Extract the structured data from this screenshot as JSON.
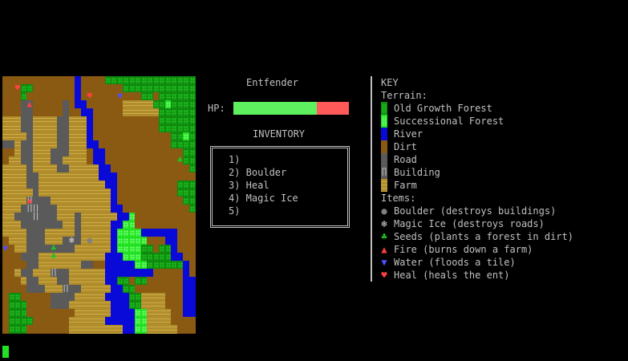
{
  "player": {
    "name": "Entfender",
    "hp_label": "HP:",
    "hp_fraction": 0.72
  },
  "inventory": {
    "title": "INVENTORY",
    "slots": [
      "1)",
      "2) Boulder",
      "3) Heal",
      "4) Magic Ice",
      "5)"
    ]
  },
  "key": {
    "title": "KEY",
    "terrain_title": "Terrain:",
    "terrain": [
      {
        "label": "Old Growth Forest",
        "icon": "old-growth-forest"
      },
      {
        "label": "Successional Forest",
        "icon": "successional-forest"
      },
      {
        "label": "River",
        "icon": "river"
      },
      {
        "label": "Dirt",
        "icon": "dirt"
      },
      {
        "label": "Road",
        "icon": "road"
      },
      {
        "label": "Building",
        "icon": "building",
        "glyph": "∏"
      },
      {
        "label": "Farm",
        "icon": "farm"
      }
    ],
    "items_title": "Items:",
    "items": [
      {
        "label": "Boulder (destroys buildings)",
        "glyph": "●",
        "color": "#808080",
        "icon": "boulder"
      },
      {
        "label": "Magic Ice (destroys roads)",
        "glyph": "❄",
        "color": "#e0e0e0",
        "icon": "magic-ice"
      },
      {
        "label": "Seeds (plants a forest in dirt)",
        "glyph": "♣",
        "color": "#22c022",
        "icon": "seeds"
      },
      {
        "label": "Fire (burns down a farm)",
        "glyph": "▲",
        "color": "#ff4040",
        "icon": "fire"
      },
      {
        "label": "Water (floods a tile)",
        "glyph": "▼",
        "color": "#5050ff",
        "icon": "water"
      },
      {
        "label": "Heal (heals the ent)",
        "glyph": "♥",
        "color": "#ff4040",
        "icon": "heal"
      }
    ]
  },
  "colors": {
    "old_growth": "#0f8a0f",
    "successional": "#22e022",
    "river": "#0a0ad8",
    "dirt": "#8a5a12",
    "road": "#5a5a5a",
    "farm": "#b08c2a",
    "hp_full": "#5ff05f",
    "hp_empty": "#ff5a5a"
  },
  "map": {
    "legend": {
      "O": "old",
      "S": "succ",
      "R": "river",
      "D": "dirt",
      "P": "road",
      "F": "farm",
      "B": "building"
    },
    "rows": [
      "DDDDDDDDDDDDRDDDDOOOOOOOOOOOOOOO",
      "DDDOODDDDDDDRDDDDDDDOOOOOOOOOOOO",
      "DDDODDDDDDDDRDDDDDDDDDDOODOOOOOO",
      "DDDPPDDDDDPDRRDDDDDDFFFFFOOSOOOO",
      "DDDPPDDDDDPDDRRDDDDDFFFFFFOOOOOO",
      "FFFPPFFFFPPFFFRDDDDDDDDDDDOOOOOO",
      "FFFPPFFFFPPFFFRDDDDDDDDDDDOOOOOO",
      "FFFFPFFFFPPFFFRDDDDDDDDDDDDDOOSO",
      "PPFPPFFFFPPFFFRRDDDDDDDDDDDDOOOO",
      "DDFPPFFFPPPFFFDRRDDDDDDDDDDDDDOO",
      "DFFPPFFFPPFFFFDRRDDDDDDDDDDDDDOO",
      "FFFFPFFFFPPFFFFFRRDDDDDDDDDDDDDO",
      "FFFFPPFFFFFFFFFFRRRDDDDDDDDDDDDD",
      "FFFFPPFFFFFFFFFFFRRDDDDDDDDDDOOO",
      "FFFFFPFFFFFFFFFFFFRDDDDDDDDDDOOO",
      "FFFFBPPPFFFFFFFFFFRDDDDDDDDDDDOO",
      "FFFPBBPPPFFFFFFFFFRRDDDDDDDDDDDO",
      "FFPPPBPPPFFFPFFFFFFRRSDDDDDDDDDD",
      "FFFPPPPPPPFFPFFFFFRRSSDDDDDDDDDD",
      "FFFFPPPFFFFFPFFFFFRSSSSRRRRRRDDD",
      "DFFFPPPFFFPPPFFFFFRSSSSSDDDRRDDD",
      "DDFFPPPPPPPPFFFFFFRSSSSOODOORDDD",
      "DDDPPPFFFFFFFFFFFRRRSSSOOOOORRDD",
      "DDDDPPFFFFFFFPPDDRRRRRSSOOOOOORD",
      "DDFPPFFFBPPFFFFFFRRRRRRRRDDDDDRD",
      "DDDFPPFFFPPFFFFFFRROODOODDDDDDRR",
      "DDDDPPPFFFBPPFFFFFRROODDDDDDDDRR",
      "DOODDDDDPPPPFFFFFRRRROOFFFFDDDRR",
      "DOOODDDDPPPFFFFFFFRRROOFFFFDDDRR",
      "DOOODDDDDDDDFFFFFFRRRRSSFFFFDDRR",
      "DOOOODDDDDDFFFFFFRRRRRSSFFFFDDDD",
      "DOOODDDDDDDFFFFFFFFFRRSSFFFFFDDD"
    ],
    "items": [
      {
        "row": 1,
        "col": 2,
        "glyph": "♥",
        "color": "#ff4040"
      },
      {
        "row": 2,
        "col": 14,
        "glyph": "♥",
        "color": "#ff4040"
      },
      {
        "row": 2,
        "col": 19,
        "glyph": "▼",
        "color": "#5050ff"
      },
      {
        "row": 3,
        "col": 4,
        "glyph": "▲",
        "color": "#ff4040"
      },
      {
        "row": 15,
        "col": 4,
        "glyph": "▲",
        "color": "#ff4040"
      },
      {
        "row": 21,
        "col": 8,
        "glyph": "♣",
        "color": "#22c022"
      },
      {
        "row": 20,
        "col": 11,
        "glyph": "❄",
        "color": "#e0e0e0"
      },
      {
        "row": 20,
        "col": 14,
        "glyph": "●",
        "color": "#808080"
      },
      {
        "row": 21,
        "col": 0,
        "glyph": "▼",
        "color": "#5050ff"
      },
      {
        "row": 22,
        "col": 8,
        "glyph": "♣",
        "color": "#22c022"
      },
      {
        "row": 10,
        "col": 29,
        "glyph": "♣",
        "color": "#22c022"
      }
    ]
  }
}
